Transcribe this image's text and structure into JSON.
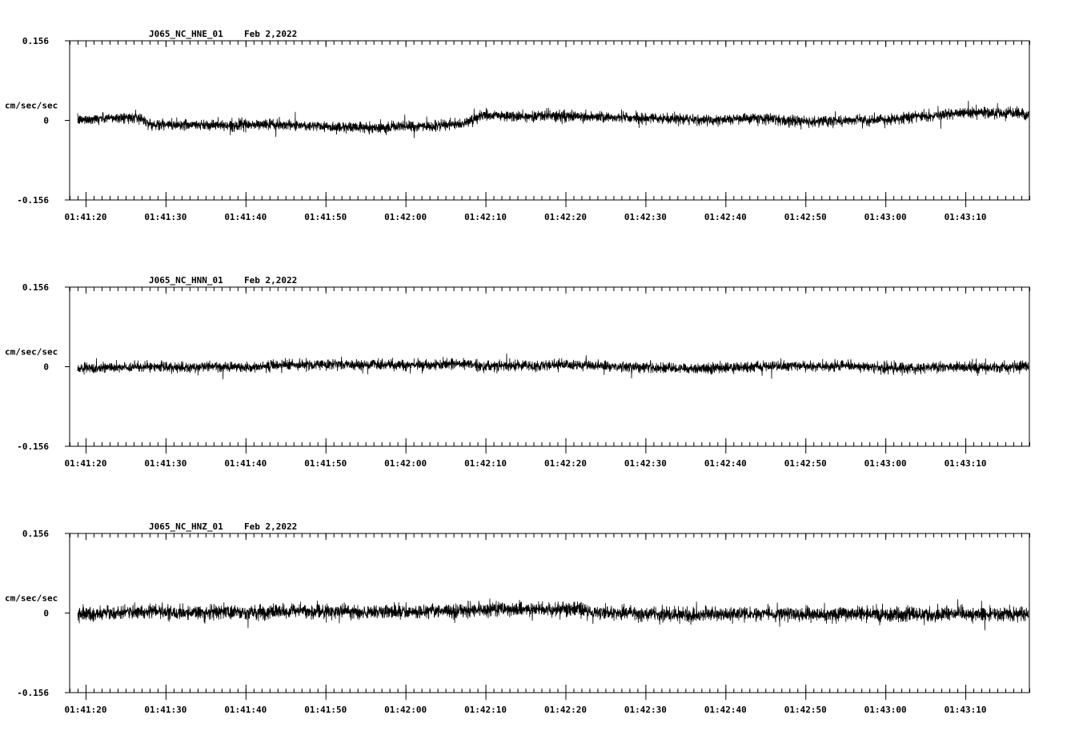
{
  "chart_data": [
    {
      "type": "line",
      "title": "J065_NC_HNE_01",
      "date": "Feb 2,2022",
      "ylabel": "cm/sec/sec",
      "ylim": [
        -0.156,
        0.156
      ],
      "y_ticks": [
        "0.156",
        "0",
        "-0.156"
      ],
      "x_ticks": [
        "01:41:20",
        "01:41:30",
        "01:41:40",
        "01:41:50",
        "01:42:00",
        "01:42:10",
        "01:42:20",
        "01:42:30",
        "01:42:40",
        "01:42:50",
        "01:43:00",
        "01:43:10"
      ],
      "xlim_seconds_from_01_41_20": [
        -2,
        118
      ],
      "series": [
        {
          "t": [
            -1,
            0,
            5,
            7,
            8,
            9,
            13,
            16,
            18,
            22,
            26,
            30,
            36,
            40,
            44,
            47,
            49,
            50,
            53,
            55,
            56,
            60,
            66,
            70,
            74,
            76,
            78,
            80,
            84,
            86,
            90,
            96,
            100,
            102,
            104,
            107,
            110,
            113,
            115,
            117.9
          ],
          "base": [
            0,
            0.002,
            0.006,
            0.004,
            -0.008,
            -0.009,
            -0.008,
            -0.009,
            -0.01,
            -0.008,
            -0.009,
            -0.012,
            -0.014,
            -0.012,
            -0.011,
            -0.007,
            0.006,
            0.01,
            0.008,
            0.006,
            0.01,
            0.008,
            0.006,
            0.004,
            0.003,
            0.002,
            0.0,
            0.002,
            0.004,
            0.002,
            -0.002,
            0.0,
            0.002,
            0.004,
            0.008,
            0.01,
            0.014,
            0.015,
            0.014,
            0.012
          ],
          "amp": [
            0.011,
            0.011,
            0.011,
            0.011,
            0.012,
            0.012,
            0.011,
            0.011,
            0.011,
            0.011,
            0.011,
            0.011,
            0.011,
            0.011,
            0.011,
            0.011,
            0.012,
            0.012,
            0.011,
            0.012,
            0.012,
            0.012,
            0.011,
            0.011,
            0.011,
            0.011,
            0.011,
            0.011,
            0.011,
            0.011,
            0.011,
            0.011,
            0.011,
            0.011,
            0.012,
            0.012,
            0.012,
            0.012,
            0.012,
            0.012
          ]
        }
      ]
    },
    {
      "type": "line",
      "title": "J065_NC_HNN_01",
      "date": "Feb 2,2022",
      "ylabel": "cm/sec/sec",
      "ylim": [
        -0.156,
        0.156
      ],
      "y_ticks": [
        "0.156",
        "0",
        "-0.156"
      ],
      "x_ticks": [
        "01:41:20",
        "01:41:30",
        "01:41:40",
        "01:41:50",
        "01:42:00",
        "01:42:10",
        "01:42:20",
        "01:42:30",
        "01:42:40",
        "01:42:50",
        "01:43:00",
        "01:43:10"
      ],
      "xlim_seconds_from_01_41_20": [
        -2,
        118
      ],
      "series": [
        {
          "t": [
            -1,
            3,
            8,
            12,
            16,
            20,
            24,
            28,
            32,
            36,
            40,
            44,
            48,
            50,
            52,
            56,
            60,
            64,
            68,
            72,
            76,
            80,
            84,
            88,
            92,
            96,
            100,
            104,
            108,
            112,
            117.9
          ],
          "base": [
            -0.004,
            -0.002,
            0.0,
            -0.002,
            0.0,
            -0.002,
            0.002,
            0.004,
            0.005,
            0.003,
            0.004,
            0.004,
            0.006,
            0.0,
            0.003,
            0.002,
            0.004,
            0.002,
            0.0,
            -0.002,
            -0.003,
            -0.002,
            0.0,
            0.002,
            0.0,
            0.002,
            -0.003,
            -0.002,
            0.0,
            -0.002,
            0.0
          ],
          "amp": [
            0.011,
            0.011,
            0.011,
            0.011,
            0.011,
            0.011,
            0.011,
            0.011,
            0.011,
            0.011,
            0.011,
            0.011,
            0.012,
            0.011,
            0.011,
            0.011,
            0.011,
            0.011,
            0.011,
            0.011,
            0.011,
            0.011,
            0.011,
            0.011,
            0.011,
            0.011,
            0.011,
            0.011,
            0.011,
            0.011,
            0.011
          ]
        }
      ]
    },
    {
      "type": "line",
      "title": "J065_NC_HNZ_01",
      "date": "Feb 2,2022",
      "ylabel": "cm/sec/sec",
      "ylim": [
        -0.156,
        0.156
      ],
      "y_ticks": [
        "0.156",
        "0",
        "-0.156"
      ],
      "x_ticks": [
        "01:41:20",
        "01:41:30",
        "01:41:40",
        "01:41:50",
        "01:42:00",
        "01:42:10",
        "01:42:20",
        "01:42:30",
        "01:42:40",
        "01:42:50",
        "01:43:00",
        "01:43:10"
      ],
      "xlim_seconds_from_01_41_20": [
        -2,
        118
      ],
      "series": [
        {
          "t": [
            -1,
            4,
            8,
            12,
            16,
            20,
            24,
            28,
            32,
            36,
            40,
            44,
            48,
            52,
            56,
            60,
            64,
            68,
            72,
            76,
            80,
            84,
            88,
            92,
            96,
            100,
            104,
            108,
            112,
            117.9
          ],
          "base": [
            -0.002,
            0.0,
            0.002,
            0.0,
            0.002,
            0.0,
            0.003,
            0.004,
            0.002,
            0.002,
            0.004,
            0.004,
            0.006,
            0.008,
            0.006,
            0.007,
            0.002,
            0.0,
            -0.002,
            -0.004,
            -0.002,
            -0.001,
            -0.002,
            -0.003,
            -0.001,
            -0.003,
            -0.004,
            -0.002,
            -0.003,
            -0.001
          ],
          "amp": [
            0.015,
            0.015,
            0.015,
            0.015,
            0.015,
            0.015,
            0.015,
            0.015,
            0.015,
            0.015,
            0.015,
            0.015,
            0.015,
            0.015,
            0.015,
            0.015,
            0.015,
            0.015,
            0.015,
            0.015,
            0.015,
            0.015,
            0.015,
            0.015,
            0.015,
            0.015,
            0.015,
            0.015,
            0.015,
            0.015
          ]
        }
      ]
    }
  ]
}
